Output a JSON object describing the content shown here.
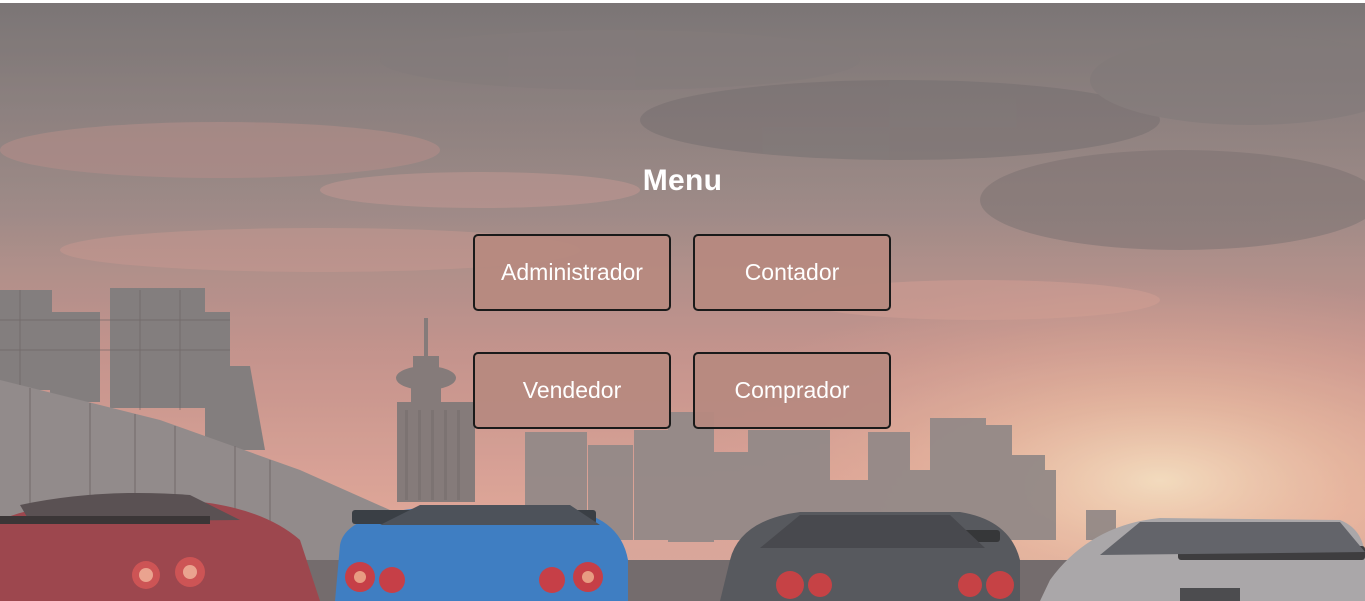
{
  "menu": {
    "title": "Menu",
    "buttons": {
      "administrador": "Administrador",
      "contador": "Contador",
      "vendedor": "Vendedor",
      "comprador": "Comprador"
    }
  },
  "colors": {
    "button_bg": "#b78980",
    "button_border": "#1a1a1a",
    "text": "#ffffff"
  }
}
